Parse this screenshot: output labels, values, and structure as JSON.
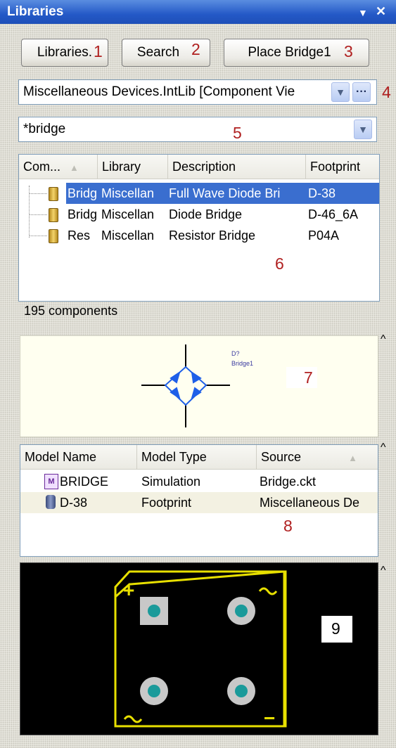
{
  "window": {
    "title": "Libraries"
  },
  "buttons": {
    "libraries": "Libraries.",
    "search": "Search",
    "place": "Place Bridge1"
  },
  "annotations": [
    "1",
    "2",
    "3",
    "4",
    "5",
    "6",
    "7",
    "8",
    "9"
  ],
  "library_select": {
    "value": "Miscellaneous Devices.IntLib [Component Vie"
  },
  "filter": {
    "value": "*bridge"
  },
  "components": {
    "columns": [
      "Com...",
      "Library",
      "Description",
      "Footprint"
    ],
    "rows": [
      {
        "name": "Bridg",
        "library": "Miscellan",
        "description": "Full Wave Diode Bri",
        "footprint": "D-38",
        "selected": true
      },
      {
        "name": "Bridg",
        "library": "Miscellan",
        "description": "Diode Bridge",
        "footprint": "D-46_6A",
        "selected": false
      },
      {
        "name": "Res",
        "library": "Miscellan",
        "description": "Resistor Bridge",
        "footprint": "P04A",
        "selected": false
      }
    ],
    "count_label": "195 components"
  },
  "preview": {
    "designator": "D?",
    "comment": "Bridge1"
  },
  "models": {
    "columns": [
      "Model Name",
      "Model Type",
      "Source"
    ],
    "rows": [
      {
        "name": "BRIDGE",
        "type": "Simulation",
        "source": "Bridge.ckt",
        "icon": "simulation-model-icon"
      },
      {
        "name": "D-38",
        "type": "Footprint",
        "source": "Miscellaneous De",
        "icon": "footprint-model-icon"
      }
    ]
  },
  "footprint": {
    "plus": "+",
    "minus": "−"
  },
  "colors": {
    "title_bar": "#2459c7",
    "selection": "#3a6ecf",
    "annotation": "#b02020",
    "pcb_outline": "#e8e000",
    "pad": "#1a9a9a"
  }
}
